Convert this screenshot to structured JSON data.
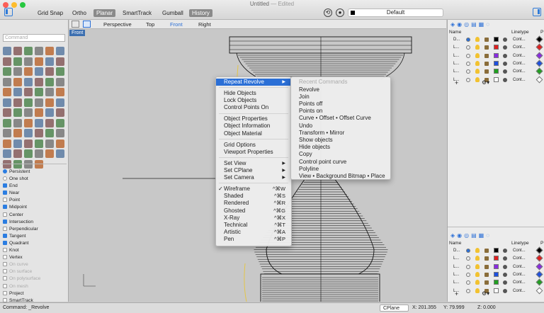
{
  "window": {
    "title": "Untitled",
    "subtitle": "— Edited"
  },
  "toolbar": [
    "Grid Snap",
    "Ortho",
    "Planar",
    "SmartTrack",
    "Gumball",
    "History"
  ],
  "toolbar_on": [
    false,
    false,
    true,
    false,
    false,
    true
  ],
  "layer_current": "Default",
  "command_placeholder": "Command",
  "viewport_tabs": [
    "Perspective",
    "Top",
    "Front",
    "Right"
  ],
  "viewport_label": "Front",
  "osnap": [
    {
      "label": "Persistent",
      "type": "radio",
      "on": true,
      "dim": false
    },
    {
      "label": "One shot",
      "type": "radio",
      "on": false,
      "dim": false
    },
    {
      "label": "End",
      "type": "cb",
      "on": true,
      "dim": false
    },
    {
      "label": "Near",
      "type": "cb",
      "on": true,
      "dim": false
    },
    {
      "label": "Point",
      "type": "cb",
      "on": false,
      "dim": false
    },
    {
      "label": "Midpoint",
      "type": "cb",
      "on": true,
      "dim": false
    },
    {
      "label": "Center",
      "type": "cb",
      "on": false,
      "dim": false
    },
    {
      "label": "Intersection",
      "type": "cb",
      "on": true,
      "dim": false
    },
    {
      "label": "Perpendicular",
      "type": "cb",
      "on": false,
      "dim": false
    },
    {
      "label": "Tangent",
      "type": "cb",
      "on": true,
      "dim": false
    },
    {
      "label": "Quadrant",
      "type": "cb",
      "on": true,
      "dim": false
    },
    {
      "label": "Knot",
      "type": "cb",
      "on": false,
      "dim": false
    },
    {
      "label": "Vertex",
      "type": "cb",
      "on": false,
      "dim": false
    },
    {
      "label": "On curve",
      "type": "cb",
      "on": false,
      "dim": true
    },
    {
      "label": "On surface",
      "type": "cb",
      "on": false,
      "dim": true
    },
    {
      "label": "On polysurface",
      "type": "cb",
      "on": false,
      "dim": true
    },
    {
      "label": "On mesh",
      "type": "cb",
      "on": false,
      "dim": true
    },
    {
      "label": "Project",
      "type": "cb",
      "on": false,
      "dim": false
    },
    {
      "label": "SmartTrack",
      "type": "cb",
      "on": false,
      "dim": false
    }
  ],
  "layers": {
    "col_name": "Name",
    "col_linetype": "Linetype",
    "col_p": "P",
    "rows": [
      {
        "name": "D...",
        "linetype": "Cont...",
        "color": "#000000"
      },
      {
        "name": "L...",
        "linetype": "Cont...",
        "color": "#e02020"
      },
      {
        "name": "L...",
        "linetype": "Cont...",
        "color": "#8a2be2"
      },
      {
        "name": "L...",
        "linetype": "Cont...",
        "color": "#1e50e0"
      },
      {
        "name": "L...",
        "linetype": "Cont...",
        "color": "#20a020"
      },
      {
        "name": "L...",
        "linetype": "Cont...",
        "color": "#ffffff"
      }
    ]
  },
  "context_menu": {
    "items": [
      {
        "label": "Repeat Revolve",
        "arrow": true,
        "hl": true
      },
      {
        "sep": true
      },
      {
        "label": "Hide Objects"
      },
      {
        "label": "Lock Objects"
      },
      {
        "label": "Control Points On"
      },
      {
        "sep": true
      },
      {
        "label": "Object Properties"
      },
      {
        "label": "Object Information"
      },
      {
        "label": "Object Material"
      },
      {
        "sep": true
      },
      {
        "label": "Grid Options"
      },
      {
        "label": "Viewport Properties"
      },
      {
        "sep": true
      },
      {
        "label": "Set View",
        "arrow": true
      },
      {
        "label": "Set CPlane",
        "arrow": true
      },
      {
        "label": "Set Camera",
        "arrow": true
      },
      {
        "sep": true
      },
      {
        "label": "Wireframe",
        "shortcut": "^⌘W",
        "checked": true
      },
      {
        "label": "Shaded",
        "shortcut": "^⌘S"
      },
      {
        "label": "Rendered",
        "shortcut": "^⌘R"
      },
      {
        "label": "Ghosted",
        "shortcut": "^⌘G"
      },
      {
        "label": "X-Ray",
        "shortcut": "^⌘X"
      },
      {
        "label": "Technical",
        "shortcut": "^⌘T"
      },
      {
        "label": "Artistic",
        "shortcut": "^⌘A"
      },
      {
        "label": "Pen",
        "shortcut": "^⌘P"
      }
    ]
  },
  "recent_menu": {
    "header": "Recent Commands",
    "items": [
      "Revolve",
      "Join",
      "Points off",
      "Points on",
      "Curve • Offset • Offset Curve",
      "Undo",
      "Transform • Mirror",
      "Show objects",
      "Hide objects",
      "Copy",
      "Control point curve",
      "Polyline",
      "View • Background Bitmap • Place"
    ]
  },
  "status": {
    "command": "Command: _Revolve",
    "cplane": "CPlane",
    "x": "X: 201.355",
    "y": "Y: 79.999",
    "z": "Z: 0.000"
  }
}
